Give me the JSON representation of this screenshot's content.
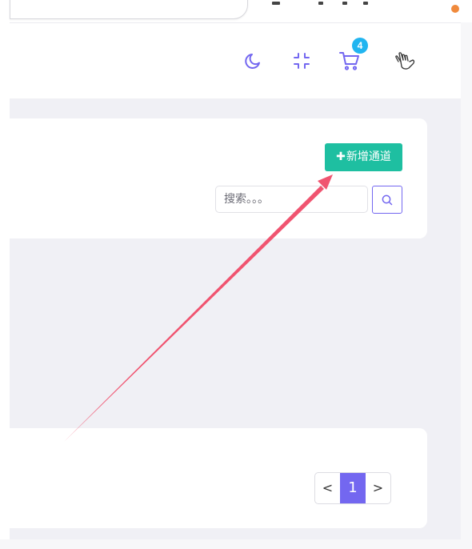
{
  "header": {
    "icons": [
      "moon-icon",
      "compress-icon",
      "cart-icon",
      "hand-icon"
    ],
    "cart_count": "4"
  },
  "toolbar": {
    "add_plus": "✚",
    "add_label": "新增通道"
  },
  "search": {
    "placeholder": "搜索。。。",
    "value": ""
  },
  "pagination": {
    "prev": "<",
    "current": "1",
    "next": ">"
  },
  "colors": {
    "accent": "#7367f0",
    "success": "#1ebfa1",
    "badge": "#21b5f0",
    "annotation_arrow": "#f05470",
    "background": "#f0f0f5"
  }
}
